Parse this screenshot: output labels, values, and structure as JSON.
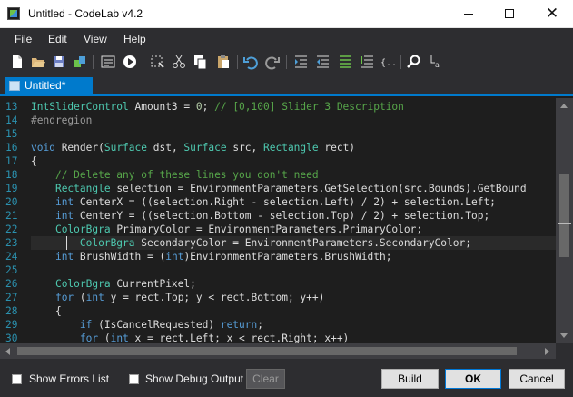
{
  "window": {
    "title": "Untitled - CodeLab v4.2"
  },
  "menu": [
    "File",
    "Edit",
    "View",
    "Help"
  ],
  "toolbar": {
    "icons": [
      "new-file-icon",
      "open-folder-icon",
      "save-icon",
      "save-dll-icon",
      "settings-icon",
      "run-icon",
      "select-region-icon",
      "cut-icon",
      "copy-icon",
      "paste-icon",
      "undo-icon",
      "redo-icon",
      "indent-icon",
      "outdent-icon",
      "comment-icon",
      "uncomment-icon",
      "snippet-icon",
      "find-icon",
      "replace-icon"
    ]
  },
  "tab": {
    "label": "Untitled*"
  },
  "editor": {
    "line_numbers": [
      "13",
      "14",
      "15",
      "16",
      "17",
      "18",
      "19",
      "20",
      "21",
      "22",
      "23",
      "24",
      "25",
      "26",
      "27",
      "28",
      "29",
      "30"
    ],
    "current_line_index": 10
  },
  "bottom": {
    "show_errors_label": "Show Errors List",
    "show_debug_label": "Show Debug Output",
    "clear_label": "Clear",
    "build_label": "Build",
    "ok_label": "OK",
    "cancel_label": "Cancel"
  },
  "colors": {
    "accent": "#007acc",
    "editor_bg": "#1e1e1e",
    "keyword": "#569cd6",
    "type": "#4ec9b0",
    "comment": "#57a64a",
    "line_number": "#2b91af"
  }
}
